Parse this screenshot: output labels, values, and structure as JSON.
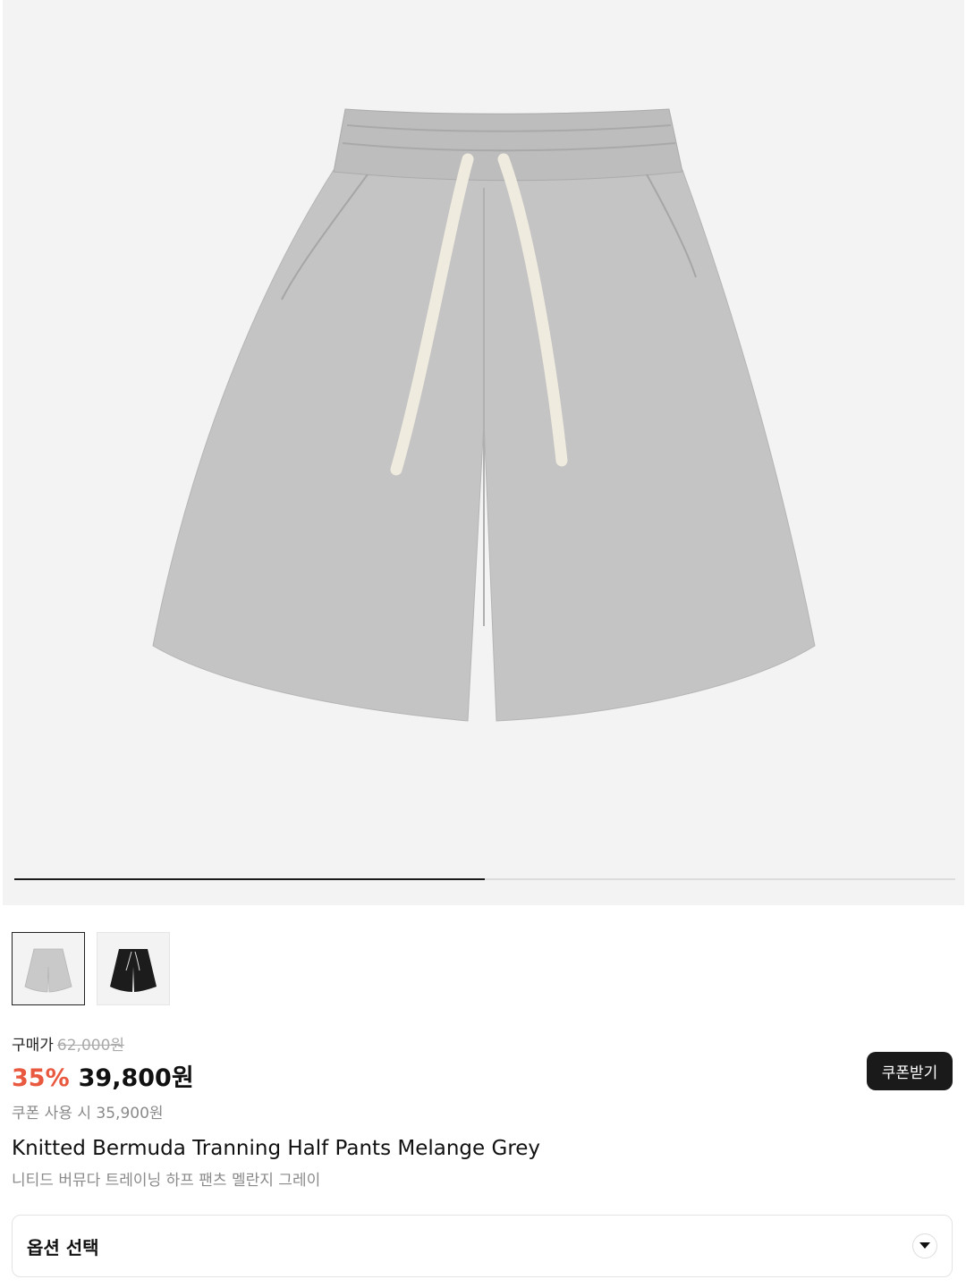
{
  "gallery": {
    "progress": 0.5,
    "main_image": "grey-shorts-photo",
    "thumbnails": [
      {
        "name": "grey-shorts-thumb",
        "color": "#c9c9c9",
        "selected": true
      },
      {
        "name": "black-shorts-thumb",
        "color": "#1c1c1c",
        "selected": false
      }
    ]
  },
  "price": {
    "label": "구매가",
    "original": "62,000원",
    "discount": "35%",
    "sale": "39,800원",
    "coupon_price": "쿠폰 사용 시 35,900원"
  },
  "coupon_button": {
    "label": "쿠폰받기"
  },
  "product": {
    "name": "Knitted Bermuda Tranning Half Pants Melange Grey",
    "subtitle": "니티드 버뮤다 트레이닝 하프 팬츠 멜란지 그레이"
  },
  "option": {
    "label": "옵션 선택"
  },
  "colors": {
    "discount": "#e8593f",
    "button_bg": "#1a1a1a",
    "hero_bg": "#f3f3f3"
  }
}
